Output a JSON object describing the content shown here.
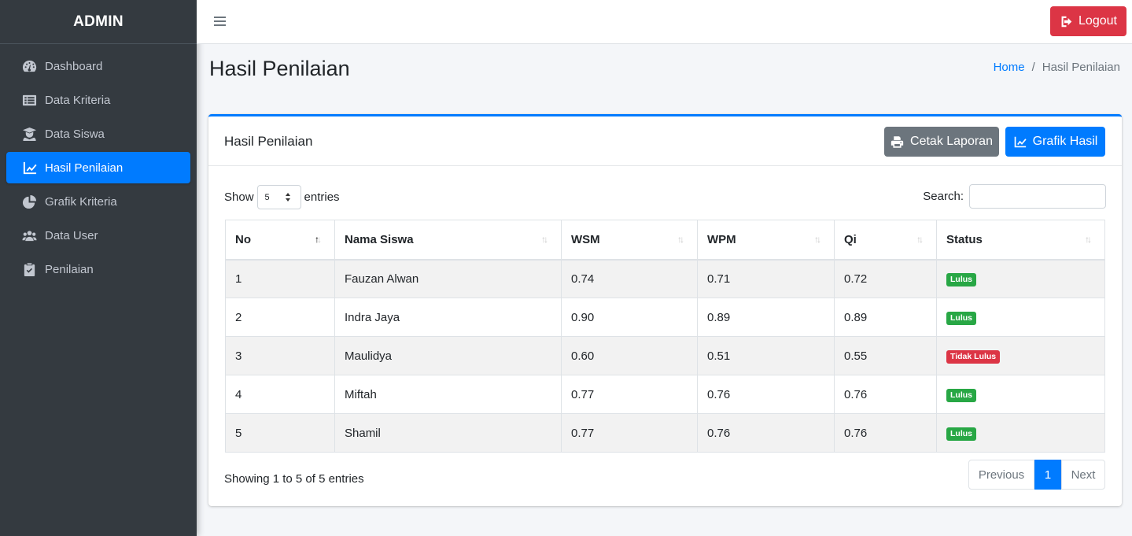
{
  "sidebar": {
    "brand": "ADMIN",
    "items": [
      {
        "label": "Dashboard",
        "icon": "tachometer-icon"
      },
      {
        "label": "Data Kriteria",
        "icon": "list-icon"
      },
      {
        "label": "Data Siswa",
        "icon": "user-graduate-icon"
      },
      {
        "label": "Hasil Penilaian",
        "icon": "chart-line-icon",
        "active": true
      },
      {
        "label": "Grafik Kriteria",
        "icon": "chart-pie-icon"
      },
      {
        "label": "Data User",
        "icon": "users-icon"
      },
      {
        "label": "Penilaian",
        "icon": "clipboard-check-icon"
      }
    ]
  },
  "topbar": {
    "logout_label": "Logout"
  },
  "header": {
    "title": "Hasil Penilaian",
    "breadcrumb": {
      "home": "Home",
      "current": "Hasil Penilaian"
    }
  },
  "card": {
    "title": "Hasil Penilaian",
    "print_label": "Cetak Laporan",
    "chart_label": "Grafik Hasil",
    "show_label": "Show",
    "entries_label": "entries",
    "page_length": "5",
    "search_label": "Search:",
    "search_value": "",
    "info": "Showing 1 to 5 of 5 entries",
    "pagination": {
      "prev": "Previous",
      "current": "1",
      "next": "Next"
    }
  },
  "table": {
    "columns": [
      "No",
      "Nama Siswa",
      "WSM",
      "WPM",
      "Qi",
      "Status"
    ],
    "rows": [
      {
        "no": "1",
        "nama": "Fauzan Alwan",
        "wsm": "0.74",
        "wpm": "0.71",
        "qi": "0.72",
        "status": "Lulus",
        "status_color": "#28a745"
      },
      {
        "no": "2",
        "nama": "Indra Jaya",
        "wsm": "0.90",
        "wpm": "0.89",
        "qi": "0.89",
        "status": "Lulus",
        "status_color": "#28a745"
      },
      {
        "no": "3",
        "nama": "Maulidya",
        "wsm": "0.60",
        "wpm": "0.51",
        "qi": "0.55",
        "status": "Tidak Lulus",
        "status_color": "#dc3545"
      },
      {
        "no": "4",
        "nama": "Miftah",
        "wsm": "0.77",
        "wpm": "0.76",
        "qi": "0.76",
        "status": "Lulus",
        "status_color": "#28a745"
      },
      {
        "no": "5",
        "nama": "Shamil",
        "wsm": "0.77",
        "wpm": "0.76",
        "qi": "0.76",
        "status": "Lulus",
        "status_color": "#28a745"
      }
    ]
  },
  "colors": {
    "primary": "#007bff",
    "danger": "#dc3545",
    "success": "#28a745",
    "secondary": "#6c757d",
    "sidebar": "#343a40"
  }
}
